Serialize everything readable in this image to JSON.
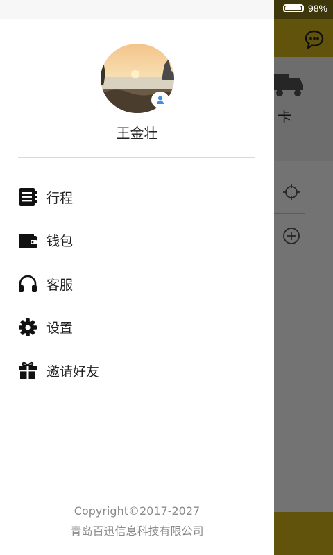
{
  "status_bar": {
    "battery_percent": "98%"
  },
  "background": {
    "truck_label": "卡"
  },
  "drawer": {
    "user_name": "王金壮",
    "menu": [
      {
        "label": "行程",
        "icon": "itinerary-book-icon"
      },
      {
        "label": "钱包",
        "icon": "wallet-icon"
      },
      {
        "label": "客服",
        "icon": "headphones-icon"
      },
      {
        "label": "设置",
        "icon": "gear-icon"
      },
      {
        "label": "邀请好友",
        "icon": "gift-icon"
      }
    ],
    "footer": {
      "copyright": "Copyright©2017-2027",
      "company": "青岛百迅信息科技有限公司"
    }
  },
  "colors": {
    "accent": "#d7b51c",
    "text": "#222222",
    "footer_text": "#8a8a8a",
    "divider": "#d9d9d9"
  }
}
